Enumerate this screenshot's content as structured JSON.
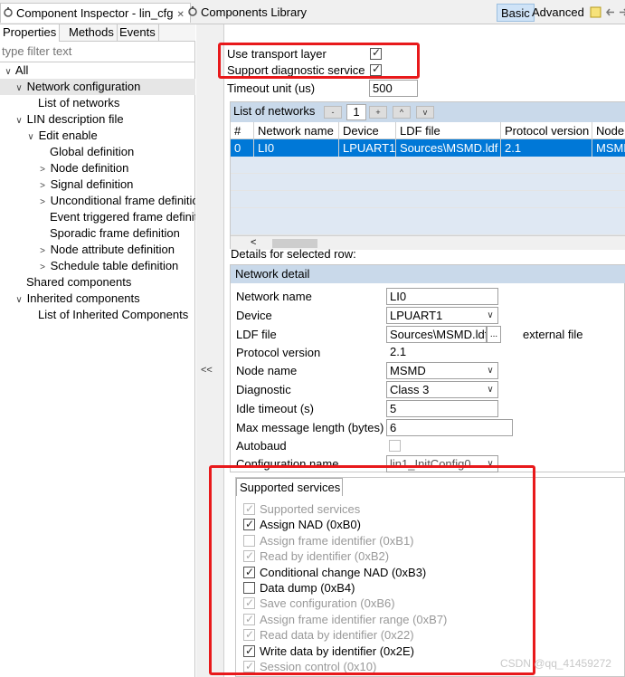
{
  "tabs": {
    "inspector": "Component Inspector - lin_cfg",
    "inspector_close": "✕",
    "library": "Components Library",
    "basic": "Basic",
    "advanced": "Advanced"
  },
  "left": {
    "subtabs": [
      "Properties",
      "Methods",
      "Events"
    ],
    "filter_placeholder": "type filter text",
    "tree": [
      {
        "label": "All",
        "twisty": "∨"
      },
      {
        "label": "Network configuration",
        "twisty": "∨"
      },
      {
        "label": "List of networks",
        "twisty": ""
      },
      {
        "label": "LIN description file",
        "twisty": "∨"
      },
      {
        "label": "Edit enable",
        "twisty": "∨"
      },
      {
        "label": "Global definition",
        "twisty": ""
      },
      {
        "label": "Node definition",
        "twisty": ">"
      },
      {
        "label": "Signal definition",
        "twisty": ">"
      },
      {
        "label": "Unconditional frame definition",
        "twisty": ">"
      },
      {
        "label": "Event triggered frame definition",
        "twisty": ""
      },
      {
        "label": "Sporadic frame definition",
        "twisty": ""
      },
      {
        "label": "Node attribute definition",
        "twisty": ">"
      },
      {
        "label": "Schedule table definition",
        "twisty": ">"
      },
      {
        "label": "Shared components",
        "twisty": ""
      },
      {
        "label": "Inherited components",
        "twisty": "∨"
      },
      {
        "label": "List of Inherited Components",
        "twisty": ""
      }
    ]
  },
  "splitter": {
    "collapse": "<<"
  },
  "top": {
    "use_transport_layer": "Use transport layer",
    "support_diagnostic_service": "Support diagnostic service",
    "timeout_unit_label": "Timeout unit (us)",
    "timeout_unit_value": "500"
  },
  "networks": {
    "title": "List of networks",
    "count": "1",
    "btn_minus": "-",
    "btn_plus": "+",
    "btn_up": "^",
    "btn_down": "v",
    "columns": [
      "#",
      "Network name",
      "Device",
      "LDF file",
      "Protocol version",
      "Node"
    ],
    "rows": [
      [
        "0",
        "LI0",
        "LPUART1",
        "Sources\\MSMD.ldf",
        "2.1",
        "MSMD"
      ]
    ],
    "scroll_left": "<"
  },
  "details_caption": "Details for selected row:",
  "detail": {
    "title": "Network detail",
    "network_name_label": "Network name",
    "network_name_value": "LI0",
    "device_label": "Device",
    "device_value": "LPUART1",
    "ldf_label": "LDF file",
    "ldf_value": "Sources\\MSMD.ldf",
    "ldf_browse": "...",
    "ldf_external": "external file",
    "protocol_label": "Protocol version",
    "protocol_value": "2.1",
    "node_name_label": "Node name",
    "node_name_value": "MSMD",
    "diagnostic_label": "Diagnostic",
    "diagnostic_value": "Class 3",
    "idle_label": "Idle timeout (s)",
    "idle_value": "5",
    "maxmsg_label": "Max message length (bytes)",
    "maxmsg_value": "6",
    "autobaud_label": "Autobaud",
    "config_label": "Configuration name",
    "config_value": "lin1_InitConfig0"
  },
  "services": {
    "title": "Supported services",
    "items": [
      {
        "label": "Supported services",
        "checked": true,
        "enabled": false
      },
      {
        "label": "Assign NAD (0xB0)",
        "checked": true,
        "enabled": true
      },
      {
        "label": "Assign frame identifier (0xB1)",
        "checked": false,
        "enabled": false
      },
      {
        "label": "Read by identifier (0xB2)",
        "checked": true,
        "enabled": false
      },
      {
        "label": "Conditional change NAD (0xB3)",
        "checked": true,
        "enabled": true
      },
      {
        "label": "Data dump (0xB4)",
        "checked": false,
        "enabled": true
      },
      {
        "label": "Save configuration (0xB6)",
        "checked": true,
        "enabled": false
      },
      {
        "label": "Assign frame identifier range (0xB7)",
        "checked": true,
        "enabled": false
      },
      {
        "label": "Read data by identifier (0x22)",
        "checked": true,
        "enabled": false
      },
      {
        "label": "Write data by identifier (0x2E)",
        "checked": true,
        "enabled": true
      },
      {
        "label": "Session control (0x10)",
        "checked": true,
        "enabled": false
      }
    ]
  },
  "watermark": "CSDN @qq_41459272",
  "colors": {
    "highlight": "#e8191b",
    "selection": "#0078d7",
    "group_header": "#c9d9ea"
  }
}
